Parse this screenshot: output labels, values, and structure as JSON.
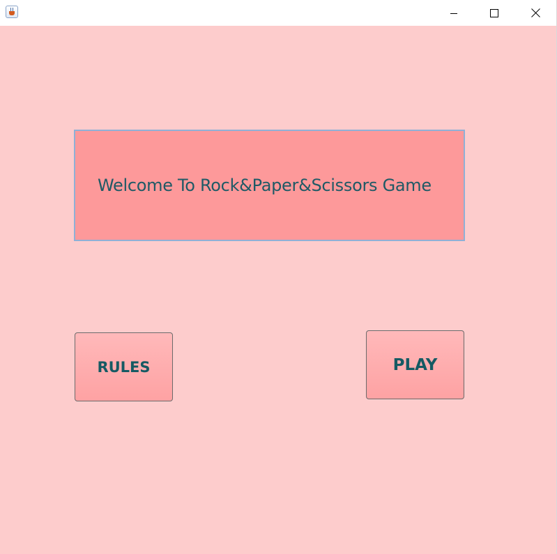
{
  "window": {
    "title": "",
    "controls": {
      "minimize_icon": "minimize-icon",
      "maximize_icon": "maximize-icon",
      "close_icon": "close-icon"
    }
  },
  "main": {
    "welcome_text": "Welcome To Rock&Paper&Scissors Game",
    "rules_label": "RULES",
    "play_label": "PLAY"
  },
  "colors": {
    "background": "#fdcccc",
    "welcome_box": "#fd999a",
    "button": "#fea2a3",
    "text": "#1f5a66"
  }
}
